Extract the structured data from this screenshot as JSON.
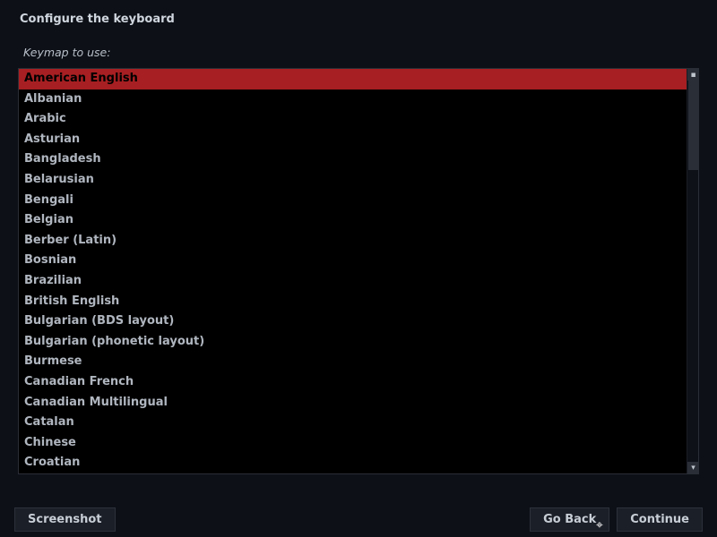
{
  "header": {
    "title": "Configure the keyboard"
  },
  "field_label": "Keymap to use:",
  "selected_index": 0,
  "keymaps": [
    "American English",
    "Albanian",
    "Arabic",
    "Asturian",
    "Bangladesh",
    "Belarusian",
    "Bengali",
    "Belgian",
    "Berber (Latin)",
    "Bosnian",
    "Brazilian",
    "British English",
    "Bulgarian (BDS layout)",
    "Bulgarian (phonetic layout)",
    "Burmese",
    "Canadian French",
    "Canadian Multilingual",
    "Catalan",
    "Chinese",
    "Croatian"
  ],
  "footer": {
    "screenshot_label": "Screenshot",
    "goback_label": "Go Back",
    "continue_label": "Continue"
  },
  "colors": {
    "bg": "#0d1017",
    "list_bg": "#000000",
    "selected_bg": "#a71f22",
    "text": "#c8ced6"
  }
}
